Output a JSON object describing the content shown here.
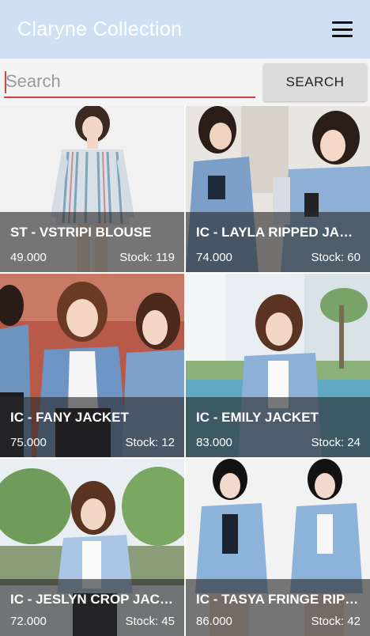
{
  "app": {
    "title": "Claryne Collection",
    "menu_icon": "hamburger-menu-icon"
  },
  "search": {
    "placeholder": "Search",
    "value": "",
    "button_label": "SEARCH"
  },
  "products": [
    {
      "name": "ST - VSTRIPI BLOUSE",
      "price": "49.000",
      "stock": "Stock: 119"
    },
    {
      "name": "IC - LAYLA RIPPED JACKET",
      "price": "74.000",
      "stock": "Stock: 60"
    },
    {
      "name": "IC - FANY JACKET",
      "price": "75.000",
      "stock": "Stock: 12"
    },
    {
      "name": "IC - EMILY JACKET",
      "price": "83.000",
      "stock": "Stock: 24"
    },
    {
      "name": "IC - JESLYN CROP  JACKET",
      "price": "72.000",
      "stock": "Stock: 45"
    },
    {
      "name": "IC - TASYA FRINGE RIPPED JACKET",
      "price": "86.000",
      "stock": "Stock: 42"
    }
  ],
  "colors": {
    "appbar": "#cfe0f5",
    "accent": "#d4413a",
    "overlay": "#282828"
  }
}
